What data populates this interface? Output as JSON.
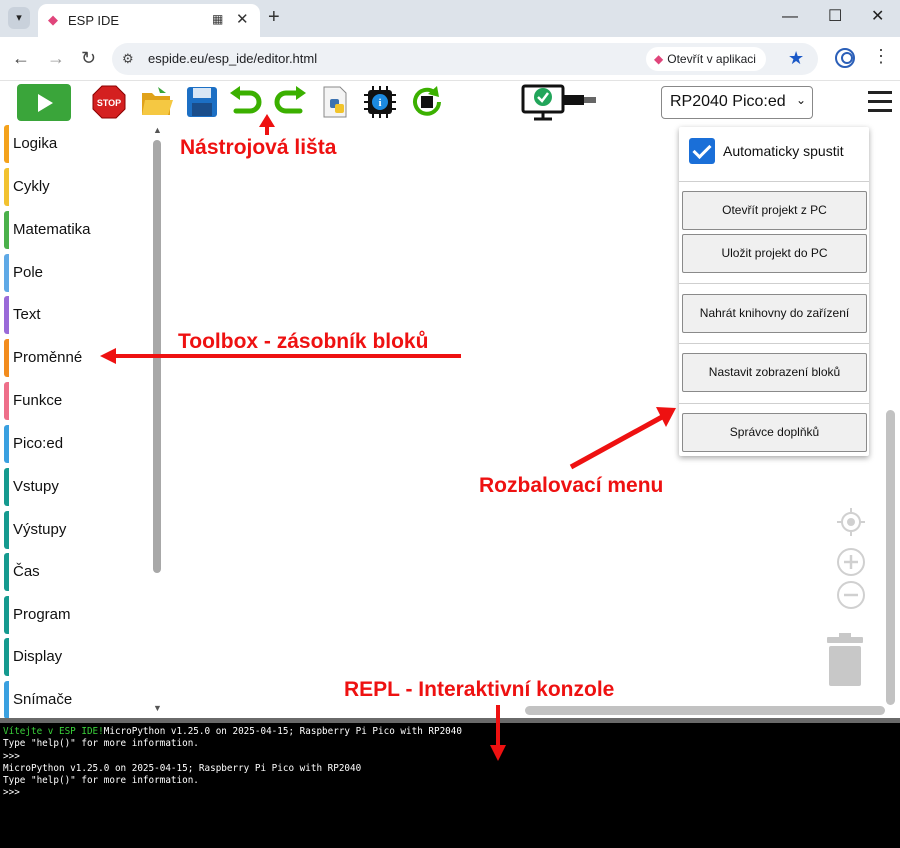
{
  "browser": {
    "tab_title": "ESP IDE",
    "url": "espide.eu/esp_ide/editor.html",
    "open_in_app": "Otevřít v aplikaci"
  },
  "toolbar": {
    "board_selected": "RP2040 Pico:ed"
  },
  "toolbox": {
    "categories": [
      {
        "label": "Logika",
        "color": "#f4a21c"
      },
      {
        "label": "Cykly",
        "color": "#f2c230"
      },
      {
        "label": "Matematika",
        "color": "#4bb14b"
      },
      {
        "label": "Pole",
        "color": "#5fa9e6"
      },
      {
        "label": "Text",
        "color": "#9a6ad8"
      },
      {
        "label": "Proměnné",
        "color": "#f28c1e"
      },
      {
        "label": "Funkce",
        "color": "#ee6f8a"
      },
      {
        "label": "Pico:ed",
        "color": "#3aa0e0"
      },
      {
        "label": "Vstupy",
        "color": "#159a8f"
      },
      {
        "label": "Výstupy",
        "color": "#159a8f"
      },
      {
        "label": "Čas",
        "color": "#159a8f"
      },
      {
        "label": "Program",
        "color": "#159a8f"
      },
      {
        "label": "Display",
        "color": "#159a8f"
      },
      {
        "label": "Snímače",
        "color": "#3aa0e0"
      }
    ]
  },
  "menu": {
    "auto_run_label": "Automaticky spustit",
    "auto_run_checked": true,
    "open_project": "Otevřít projekt z PC",
    "save_project": "Uložit projekt do PC",
    "upload_libraries": "Nahrát knihovny do zařízení",
    "block_display": "Nastavit zobrazení bloků",
    "plugin_manager": "Správce doplňků"
  },
  "console": {
    "welcome": "Vítejte v ESP IDE!",
    "lines": [
      "MicroPython v1.25.0 on 2025-04-15; Raspberry Pi Pico with RP2040",
      "Type \"help()\" for more information.",
      ">>>",
      "MicroPython v1.25.0 on 2025-04-15; Raspberry Pi Pico with RP2040",
      "Type \"help()\" for more information.",
      ">>>"
    ]
  },
  "annotations": {
    "toolbar": "Nástrojová lišta",
    "toolbox": "Toolbox - zásobník bloků",
    "dropdown": "Rozbalovací menu",
    "repl": "REPL - Interaktivní konzole"
  },
  "colors": {
    "annotation": "#ee1111",
    "run_button": "#3aa53a",
    "accent": "#1a6fd8"
  }
}
